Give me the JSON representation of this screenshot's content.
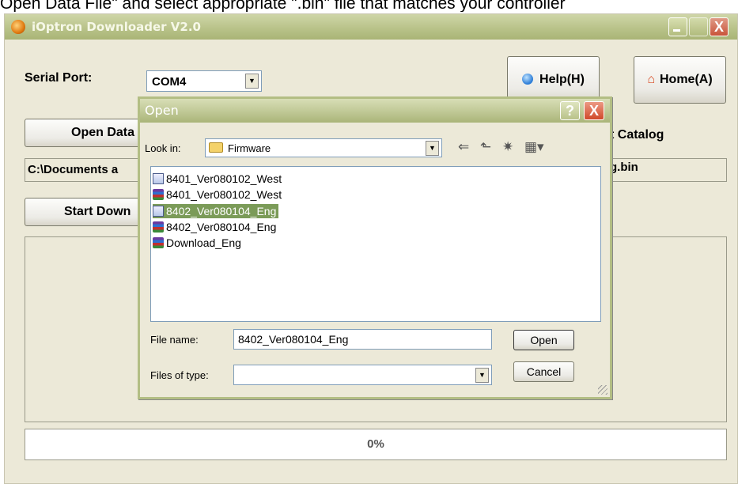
{
  "caption": "Open Data File\" and select appropriate \".bin\" file that matches your controller",
  "window": {
    "title": "iOptron Downloader V2.0",
    "close_glyph": "X"
  },
  "serial": {
    "label": "Serial Port:",
    "value": "COM4"
  },
  "buttons": {
    "help": "Help(H)",
    "home": "Home(A)",
    "open_data": "Open Data",
    "start_download": "Start Down",
    "catalog": "t Catalog"
  },
  "path": {
    "left": "C:\\Documents a",
    "right": "g.bin"
  },
  "progress": {
    "text": "0%",
    "value": 0
  },
  "dialog": {
    "title": "Open",
    "help_glyph": "?",
    "close_glyph": "X",
    "look_in_label": "Look in:",
    "look_in_value": "Firmware",
    "files": [
      {
        "name": "8401_Ver080102_West",
        "icon": "bin-file-icon"
      },
      {
        "name": "8401_Ver080102_West",
        "icon": "rar-archive-icon"
      },
      {
        "name": "8402_Ver080104_Eng",
        "icon": "bin-file-icon",
        "selected": true
      },
      {
        "name": "8402_Ver080104_Eng",
        "icon": "rar-archive-icon"
      },
      {
        "name": "Download_Eng",
        "icon": "rar-archive-icon"
      }
    ],
    "file_name_label": "File name:",
    "file_name_value": "8402_Ver080104_Eng",
    "file_type_label": "Files of type:",
    "file_type_value": "",
    "open_button": "Open",
    "cancel_button": "Cancel"
  },
  "colors": {
    "selection": "#7b9b58",
    "window_face": "#ece9d8",
    "title_bar": "#b9c38a"
  }
}
